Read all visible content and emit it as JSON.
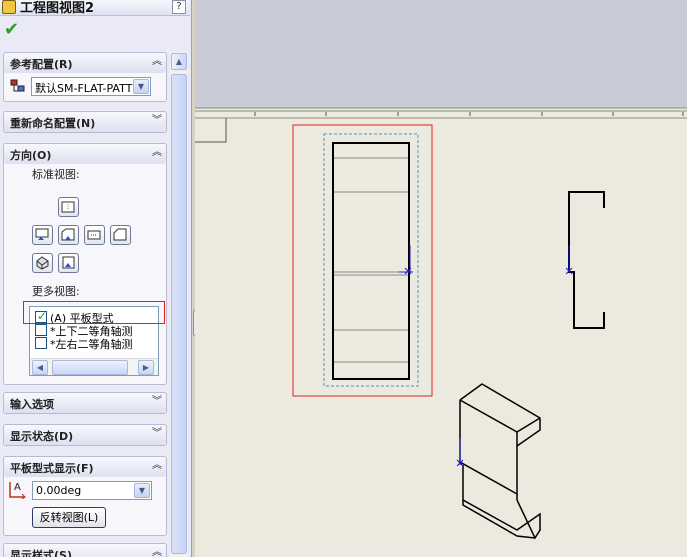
{
  "panel": {
    "title": "工程图视图2",
    "help": "?",
    "ok_icon": "check-icon"
  },
  "reference_config": {
    "header": "参考配置(R)",
    "value": "默认SM-FLAT-PATT"
  },
  "rename_config": {
    "header": "重新命名配置(N)"
  },
  "orientation": {
    "header": "方向(O)",
    "standard_views_label": "标准视图:",
    "more_views_label": "更多视图:",
    "more_views": [
      {
        "label": "(A) 平板型式",
        "checked": true
      },
      {
        "label": "*上下二等角轴测",
        "checked": false
      },
      {
        "label": "*左右二等角轴测",
        "checked": false
      }
    ]
  },
  "import_options": {
    "header": "输入选项"
  },
  "display_state": {
    "header": "显示状态(D)"
  },
  "flat_pattern_display": {
    "header": "平板型式显示(F)",
    "angle_value": "0.00deg",
    "flip_button": "反转视图(L)"
  },
  "display_style": {
    "header": "显示样式(S)"
  },
  "colors": {
    "highlight": "#e02020",
    "sketch_blue": "#1a1ad0",
    "check_green": "#2e9e1e"
  }
}
